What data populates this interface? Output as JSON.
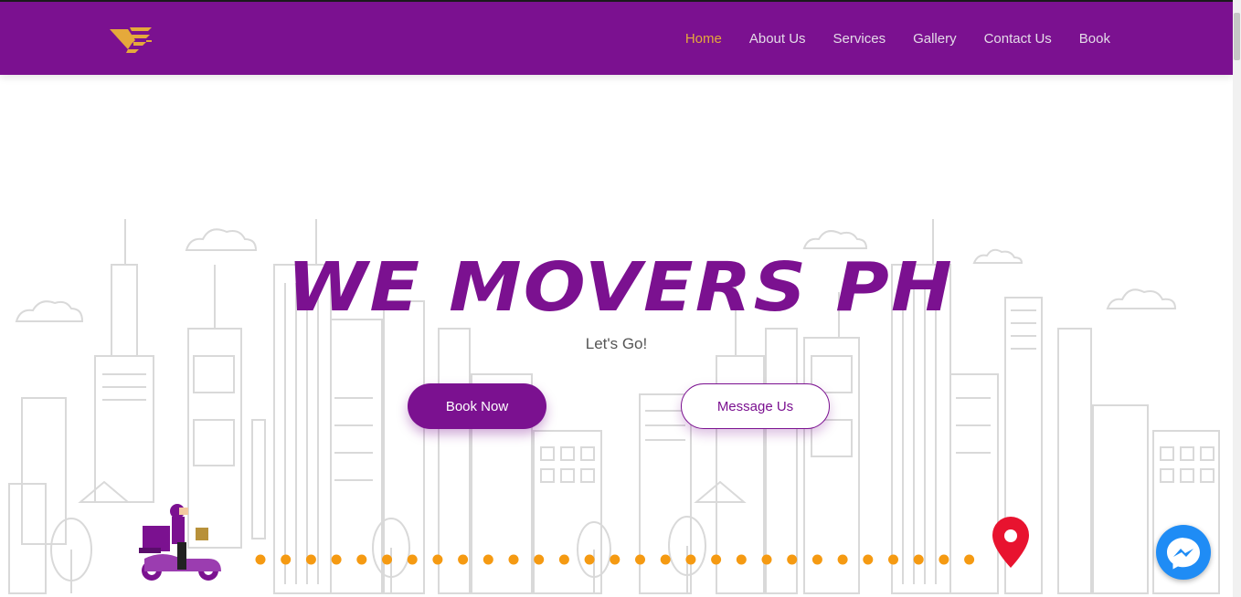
{
  "brand": {
    "logo_icon": "we-movers-logo-icon",
    "colors": {
      "primary": "#7b1190",
      "accent": "#e5a93b",
      "route_dot": "#f59a12",
      "pin": "#e8132f",
      "messenger": "#1f8cf5"
    }
  },
  "nav": {
    "items": [
      {
        "label": "Home",
        "active": true
      },
      {
        "label": "About Us",
        "active": false
      },
      {
        "label": "Services",
        "active": false
      },
      {
        "label": "Gallery",
        "active": false
      },
      {
        "label": "Contact Us",
        "active": false
      },
      {
        "label": "Book",
        "active": false
      }
    ]
  },
  "hero": {
    "title": "WE MOVERS PH",
    "tagline": "Let's Go!",
    "book_button": "Book Now",
    "message_button": "Message Us"
  },
  "illustration": {
    "scene": "city-skyline-illustration",
    "rider_icon": "delivery-scooter-icon",
    "pin_icon": "location-pin-icon"
  },
  "chat": {
    "icon": "messenger-icon"
  }
}
